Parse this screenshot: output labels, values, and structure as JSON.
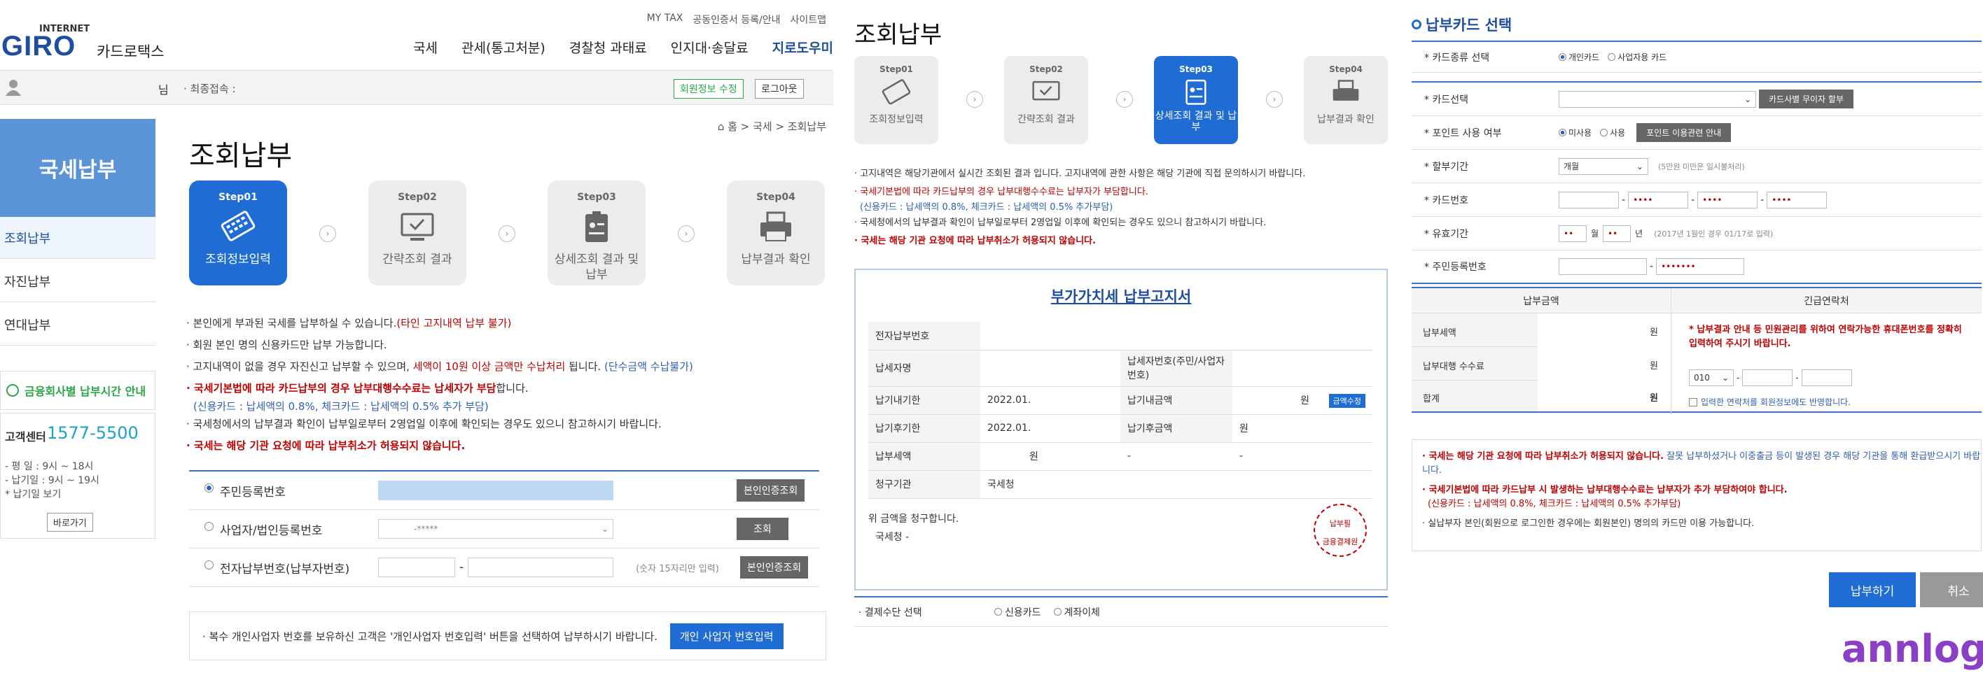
{
  "panel1": {
    "top_links": [
      "MY TAX",
      "공동인증서 등록/안내",
      "사이트맵"
    ],
    "logo": {
      "internet": "INTERNET",
      "giro": "GIRO",
      "sub": "카드로택스"
    },
    "nav": [
      "국세",
      "관세(통고처분)",
      "경찰청 과태료",
      "인지대·송달료",
      "지로도우미"
    ],
    "user": {
      "suffix": "님",
      "last_login": "· 최종접속 :",
      "edit_btn": "회원정보 수정",
      "logout_btn": "로그아웃"
    },
    "lnb": {
      "title": "국세납부",
      "items": [
        "조회납부",
        "자진납부",
        "연대납부"
      ],
      "hours_btn": "금융회사별 납부시간 안내",
      "call_label": "고객센터",
      "call_number": "1577-5500",
      "hours": [
        "- 평   일 : 9시 ~ 18시",
        "- 납기일 : 9시 ~ 19시",
        "* 납기일 보기"
      ],
      "go_btn": "바로가기"
    },
    "page_title": "조회납부",
    "breadcrumb": "홈 > 국세 > 조회납부",
    "steps": [
      {
        "num": "Step01",
        "label": "조회정보입력"
      },
      {
        "num": "Step02",
        "label": "간략조회 결과"
      },
      {
        "num": "Step03",
        "label": "상세조회 결과 및 납부"
      },
      {
        "num": "Step04",
        "label": "납부결과 확인"
      }
    ],
    "notes": {
      "n1a": "· 본인에게 부과된 국세를 납부하실 수 있습니다.",
      "n1b": "(타인 고지내역 납부 불가)",
      "n2": "· 회원 본인 명의 신용카드만 납부 가능합니다.",
      "n3a": "· 고지내역이 없을 경우 자진신고 납부할 수 있으며, ",
      "n3b": "세액이 10원 이상 금액만 수납처리",
      "n3c": " 됩니다. ",
      "n3d": "(단수금액 수납불가)",
      "n4a": "· 국세기본법에 따라 카드납부의 경우 납부대행수수료는 납세자가 부담",
      "n4b": "합니다.",
      "n4c": "(신용카드 : 납세액의 0.8%, 체크카드 : 납세액의 0.5% 추가 부담)",
      "n5": "· 국세청에서의 납부결과 확인이 납부일로부터 2영업일 이후에 확인되는 경우도 있으니 참고하시기 바랍니다.",
      "n6": "· 국세는 해당 기관 요청에 따라 납부취소가 허용되지 않습니다."
    },
    "form": {
      "r1_label": "주민등록번호",
      "r1_btn": "본인인증조회",
      "r2_label": "사업자/법인등록번호",
      "r2_value": "-*****",
      "r2_btn": "조회",
      "r3_label": "전자납부번호(납부자번호)",
      "r3_hint": "(숫자 15자리만 입력)",
      "r3_btn": "본인인증조회"
    },
    "footer_note": "· 복수 개인사업자 번호를 보유하신 고객은 '개인사업자 번호입력' 버튼을 선택하여 납부하시기 바랍니다.",
    "footer_btn": "개인 사업자 번호입력"
  },
  "panel2": {
    "title": "조회납부",
    "steps": [
      {
        "num": "Step01",
        "label": "조회정보입력"
      },
      {
        "num": "Step02",
        "label": "간략조회 결과"
      },
      {
        "num": "Step03",
        "label": "상세조회 결과 및 납부"
      },
      {
        "num": "Step04",
        "label": "납부결과 확인"
      }
    ],
    "notes": {
      "a": "· 고지내역은 해당기관에서 실시간 조회된 결과 입니다. 고지내역에 관한 사항은 해당 기관에 직접 문의하시기 바랍니다.",
      "b": "· 국세기본법에 따라 카드납부의 경우 납부대행수수료는 납부자가 부담합니다.",
      "c": "(신용카드 : 납세액의 0.8%, 체크카드 : 납세액의 0.5% 추가부담)",
      "d": "· 국세청에서의 납부결과 확인이 납부일로부터 2영업일 이후에 확인되는 경우도 있으니 참고하시기 바랍니다.",
      "e": "· 국세는 해당 기관 요청에 따라 납부취소가 허용되지 않습니다."
    },
    "bill": {
      "title": "부가가치세 납부고지서",
      "r1": "전자납부번호",
      "r2a": "납세자명",
      "r2b": "납세자번호(주민/사업자번호)",
      "r3a": "납기내기한",
      "r3v": "2022.01.",
      "r3b": "납기내금액",
      "r3w": "원",
      "r3btn": "금액수정",
      "r4a": "납기후기한",
      "r4v": "2022.01.",
      "r4b": "납기후금액",
      "r4w": "원",
      "r5a": "납부세액",
      "r5w": "원",
      "r5b": "-",
      "r5c": "-",
      "r6a": "청구기관",
      "r6v": "국세청",
      "claim": "위 금액을 청구합니다.",
      "org": "국세청 -",
      "stamp1": "납부필",
      "stamp2": "금융결제원"
    },
    "pay_method": {
      "label": "· 결제수단 선택",
      "opt1": "신용카드",
      "opt2": "계좌이체"
    }
  },
  "panel3": {
    "title": "납부카드 선택",
    "rows": {
      "kind": "* 카드종류 선택",
      "kind_o1": "개인카드",
      "kind_o2": "사업자용 카드",
      "card": "* 카드선택",
      "card_btn": "카드사별 무이자 할부",
      "point": "* 포인트 사용 여부",
      "point_o1": "미사용",
      "point_o2": "사용",
      "point_btn": "포인트 이용관련 안내",
      "inst": "* 할부기간",
      "inst_val": "개월",
      "inst_hint": "(5만원 미만은 일시불처리)",
      "cardno": "* 카드번호",
      "mask": "••••",
      "exp": "* 유효기간",
      "exp_m": "월",
      "exp_y": "년",
      "exp_hint": "(2017년 1월인 경우 01/17로 입력)",
      "rrn": "* 주민등록번호",
      "rrn_mask": "•••••••"
    },
    "summary": {
      "col1": "납부금액",
      "col2": "긴급연락처",
      "r1": "납부세액",
      "r2": "납부대행 수수료",
      "r3": "합계",
      "won": "원",
      "warn": "* 납부결과 안내 등 민원관리를 위하여 연락가능한 휴대폰번호를 정확히 입력하여 주시기 바랍니다.",
      "phone1": "010",
      "chk": "입력한 연락처를 회원정보에도 반영합니다."
    },
    "notes": {
      "a1": "· 국세는 해당 기관 요청에 따라 납부취소가 허용되지 않습니다.",
      "a2": " 잘못 납부하셨거나 이중출금 등이 발생된 경우 해당 기관을 통해 환급받으시기 바랍니다.",
      "b": "· 국세기본법에 따라 카드납부 시 발생하는 납부대행수수료는 납부자가 추가 부담하여야 합니다.",
      "c": "(신용카드 : 납세액의 0.8%, 체크카드 : 납세액의 0.5% 추가부담)",
      "d": "· 실납부자 본인(회원으로 로그인한 경우에는 회원본인) 명의의 카드만 이용 가능합니다."
    },
    "pay_btn": "납부하기",
    "cancel_btn": "취소",
    "watermark": "annlog"
  },
  "colors": {
    "accent": "#1e6cd4",
    "red": "#c00000",
    "lnb": "#5a93d6"
  }
}
